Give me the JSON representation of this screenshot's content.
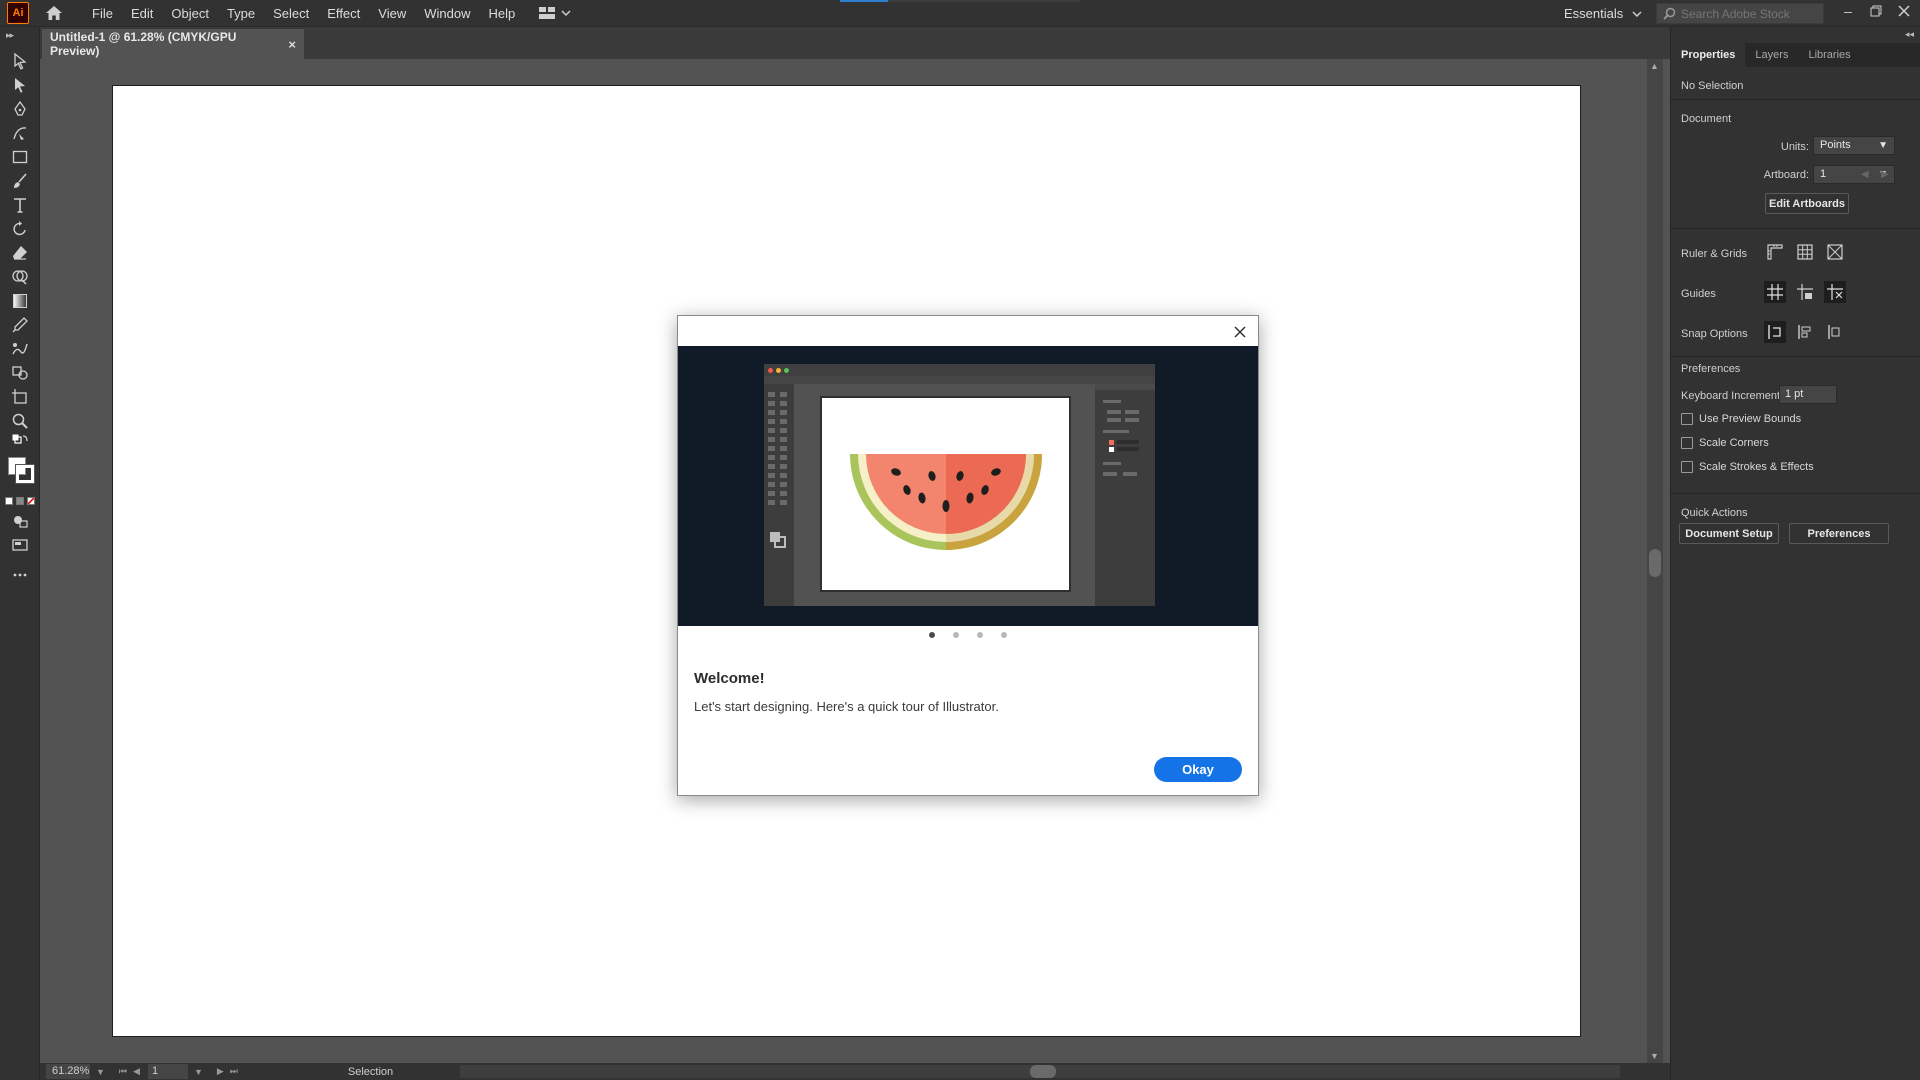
{
  "app": {
    "logo_text": "Ai",
    "menu": [
      "File",
      "Edit",
      "Object",
      "Type",
      "Select",
      "Effect",
      "View",
      "Window",
      "Help"
    ],
    "workspace": "Essentials",
    "search_placeholder": "Search Adobe Stock",
    "accent_color": "#1473e6",
    "logo_color": "#ff7c00"
  },
  "document": {
    "tab_title": "Untitled-1 @ 61.28% (CMYK/GPU Preview)",
    "tab_close": "×"
  },
  "status_bar": {
    "zoom": "61.28%",
    "artboard_number": "1",
    "tool_status": "Selection"
  },
  "panel": {
    "tabs": [
      "Properties",
      "Layers",
      "Libraries"
    ],
    "selection_state": "No Selection",
    "document_section": "Document",
    "units_label": "Units:",
    "units_value": "Points",
    "artboard_label": "Artboard:",
    "artboard_value": "1",
    "edit_artboards": "Edit Artboards",
    "rulers_grids": "Ruler & Grids",
    "guides": "Guides",
    "snap_options": "Snap Options",
    "preferences_section": "Preferences",
    "keyboard_increment_label": "Keyboard Increment:",
    "keyboard_increment_value": "1 pt",
    "checkboxes": [
      "Use Preview Bounds",
      "Scale Corners",
      "Scale Strokes & Effects"
    ],
    "quick_actions": "Quick Actions",
    "document_setup": "Document Setup",
    "preferences_button": "Preferences"
  },
  "dialog": {
    "title": "Welcome!",
    "body": "Let's start designing. Here's a quick tour of Illustrator.",
    "okay": "Okay",
    "page_count": 4,
    "active_page": 1
  }
}
